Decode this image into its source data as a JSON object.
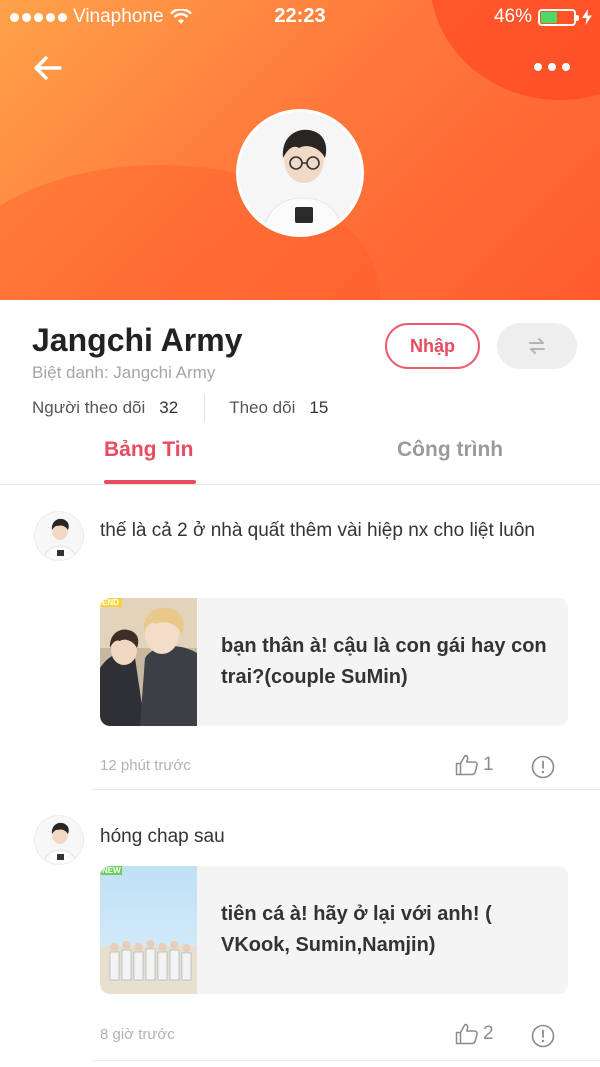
{
  "status_bar": {
    "carrier": "Vinaphone",
    "time": "22:23",
    "battery": "46%",
    "battery_level": 0.46
  },
  "header": {
    "back_icon": "arrow-left-icon",
    "more_icon": "more-horizontal-icon",
    "gradient_colors": [
      "#ffa24a",
      "#ff5a2e"
    ]
  },
  "profile": {
    "name": "Jangchi Army",
    "nickname_label": "Biệt danh:",
    "nickname": "Jangchi Army",
    "followers_label": "Người theo dõi",
    "followers_count": "32",
    "following_label": "Theo dõi",
    "following_count": "15",
    "primary_button": "Nhập",
    "swap_icon": "swap-icon",
    "accent_color": "#ea4b5f"
  },
  "tabs": [
    {
      "label": "Bảng Tin",
      "active": true
    },
    {
      "label": "Công trình",
      "active": false
    }
  ],
  "posts": [
    {
      "text": "thế là cả 2 ở nhà quất thêm vài hiệp nx cho liệt luôn",
      "story_badge": "END",
      "story_title": "bạn thân à! cậu là con gái hay con trai?(couple SuMin)",
      "time": "12 phút trước",
      "likes": "1"
    },
    {
      "text": "hóng chap sau",
      "story_badge": "NEW",
      "story_title": "tiên cá à! hãy ở lại với anh! ( VKook, Sumin,Namjin)",
      "time": "8 giờ trước",
      "likes": "2"
    }
  ]
}
